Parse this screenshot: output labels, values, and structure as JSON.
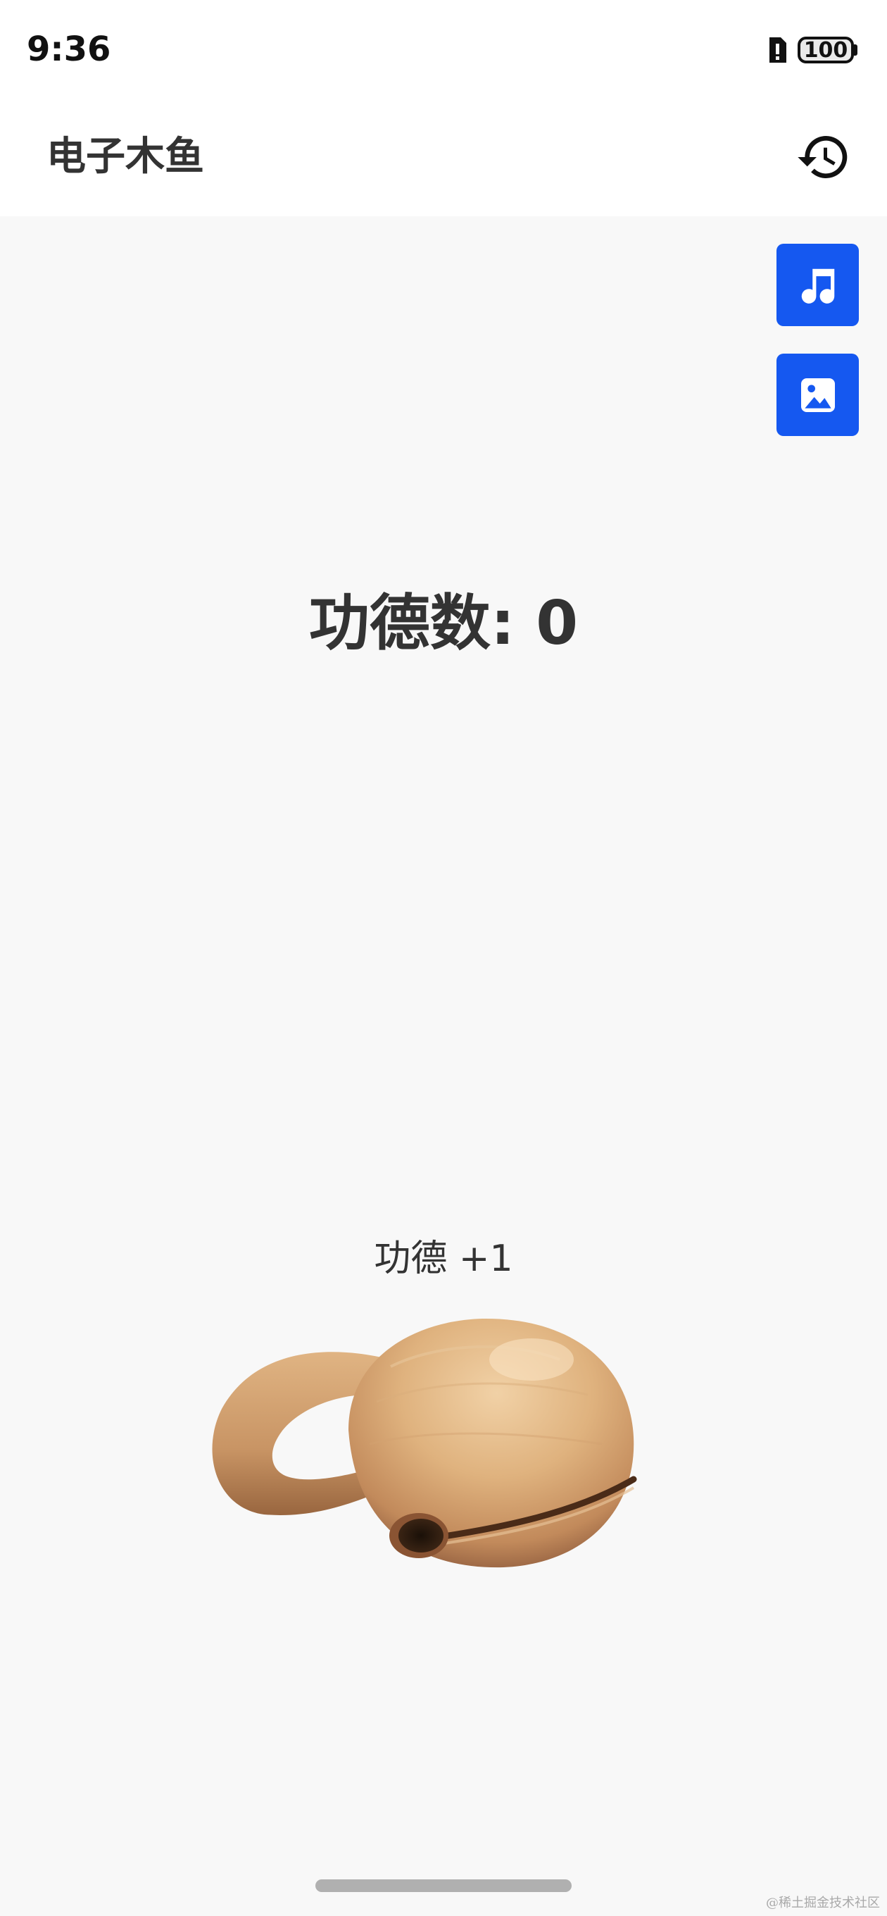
{
  "status_bar": {
    "time": "9:36",
    "battery_level": "100",
    "icons": [
      "alert-sim-icon",
      "battery-icon"
    ]
  },
  "app_bar": {
    "title": "电子木鱼",
    "history_icon": "history-icon"
  },
  "side_buttons": [
    {
      "icon": "music-note-icon"
    },
    {
      "icon": "image-icon"
    }
  ],
  "counter": {
    "text": "功德数: 0",
    "value": 0
  },
  "merit_popup": "功德 +1",
  "muyu_image": "wooden-fish-image",
  "watermark": "@稀土掘金技术社区",
  "colors": {
    "accent": "#1558f0",
    "background": "#f8f8f8",
    "text": "#333333"
  }
}
